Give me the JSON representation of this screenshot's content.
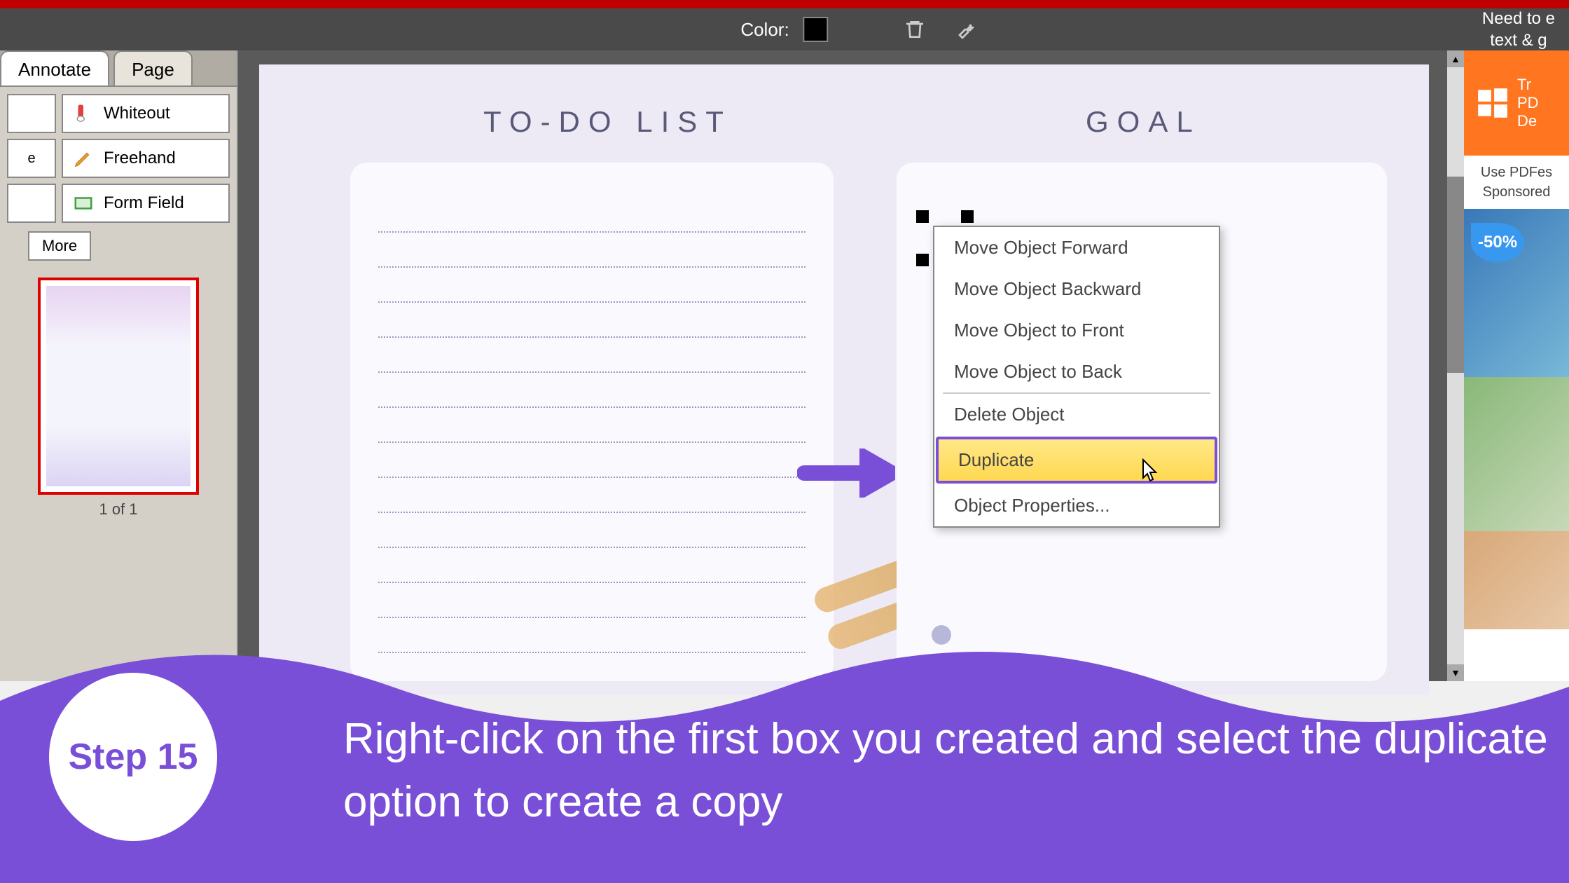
{
  "toolbar": {
    "color_label": "Color:",
    "help_text": "Need to e\ntext & g"
  },
  "tabs": {
    "annotate": "Annotate",
    "page": "Page"
  },
  "tools": {
    "whiteout": "Whiteout",
    "freehand": "Freehand",
    "formfield": "Form Field",
    "more": "More"
  },
  "thumbnail": {
    "caption": "1 of 1"
  },
  "page": {
    "todo_heading": "TO-DO LIST",
    "goal_heading": "GOAL"
  },
  "context_menu": {
    "items": [
      "Move Object Forward",
      "Move Object Backward",
      "Move Object to Front",
      "Move Object to Back"
    ],
    "delete": "Delete Object",
    "duplicate": "Duplicate",
    "properties": "Object Properties..."
  },
  "promo": {
    "line1": "Tr",
    "line2": "PD",
    "line3": "De",
    "sponsor": "Use PDFes\nSponsored",
    "discount": "-50%"
  },
  "banner": {
    "step": "Step 15",
    "instruction": "Right-click on the first box you created and select the duplicate option to create a copy"
  }
}
